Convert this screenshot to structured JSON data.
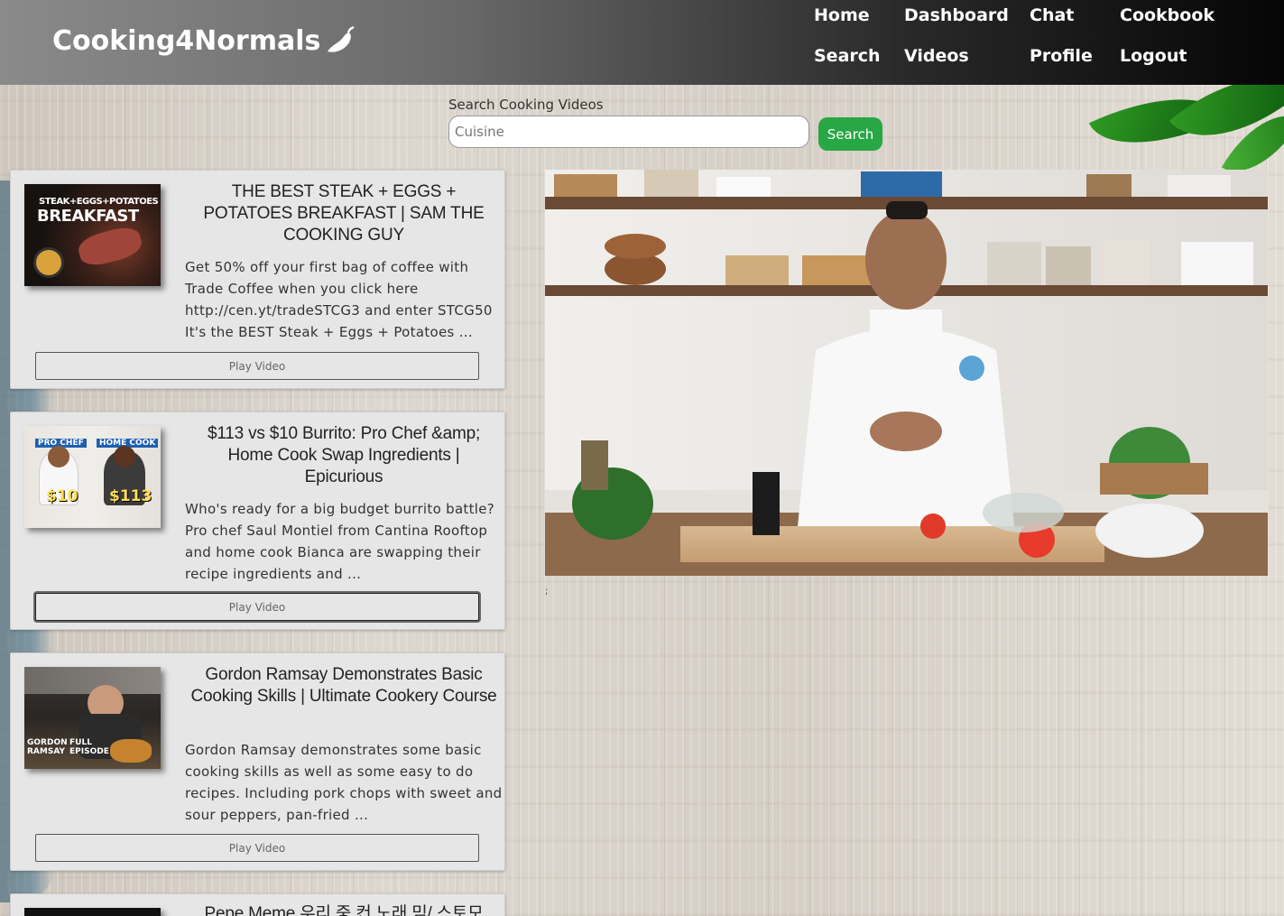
{
  "brand": {
    "name": "Cooking4Normals",
    "icon": "pepper-icon"
  },
  "nav": {
    "home": "Home",
    "dashboard": "Dashboard",
    "chat": "Chat",
    "cookbook": "Cookbook",
    "search": "Search",
    "videos": "Videos",
    "profile": "Profile",
    "logout": "Logout"
  },
  "search": {
    "label": "Search Cooking Videos",
    "placeholder": "Cuisine",
    "value": "",
    "button": "Search"
  },
  "videos": [
    {
      "title": "THE BEST STEAK + EGGS + POTATOES BREAKFAST | SAM THE COOKING GUY",
      "description": "Get 50% off your first bag of coffee with Trade Coffee when you click here http://cen.yt/tradeSTCG3 and enter STCG50 It's the BEST Steak + Eggs + Potatoes ...",
      "thumb_text": [
        "STEAK+EGGS+POTATOES",
        "BREAKFAST"
      ],
      "play_label": "Play Video"
    },
    {
      "title": "$113 vs $10 Burrito: Pro Chef &amp; Home Cook Swap Ingredients | Epicurious",
      "description": "Who's ready for a big budget burrito battle? Pro chef Saul Montiel from Cantina Rooftop and home cook Bianca are swapping their recipe ingredients and ...",
      "thumb_text": [
        "PRO CHEF",
        "HOME COOK",
        "$10",
        "$113"
      ],
      "play_label": "Play Video"
    },
    {
      "title": "Gordon Ramsay Demonstrates Basic Cooking Skills | Ultimate Cookery Course",
      "description": "Gordon Ramsay demonstrates some basic cooking skills as well as some easy to do recipes. Including pork chops with sweet and sour peppers, pan-fried ...",
      "thumb_text": [
        "GORDON",
        "RAMSAY",
        "FULL",
        "EPISODE"
      ],
      "play_label": "Play Video"
    },
    {
      "title": "Pepe Meme 우리 중 컨 노래 밈/ 스토모"
    }
  ],
  "player": {
    "stray_mark": ";"
  },
  "colors": {
    "search_button": "#28a745",
    "card_bg": "#e6e6e6"
  }
}
